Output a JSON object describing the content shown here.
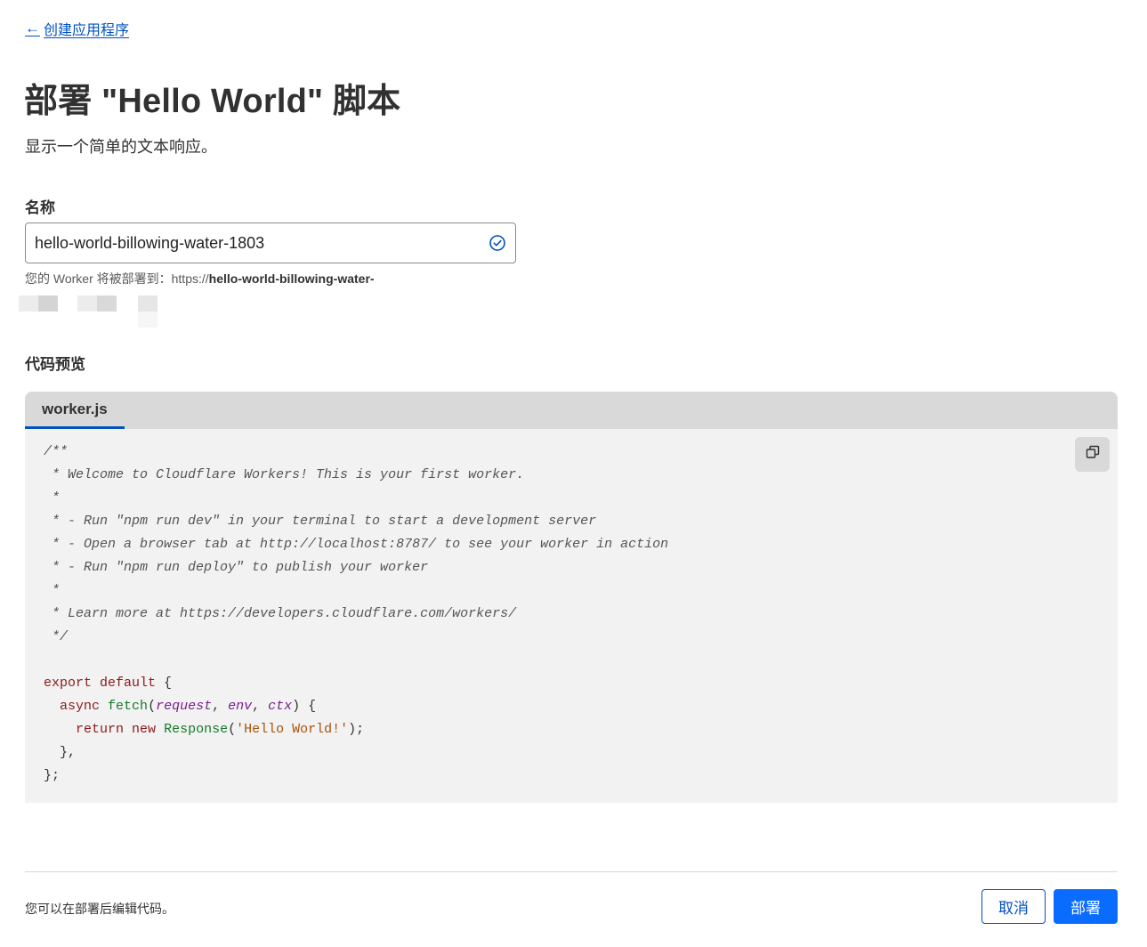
{
  "nav": {
    "back_label": "创建应用程序"
  },
  "header": {
    "title": "部署 \"Hello World\" 脚本",
    "subtitle": "显示一个简单的文本响应。"
  },
  "form": {
    "name_label": "名称",
    "name_value": "hello-world-billowing-water-1803",
    "url_hint_prefix": "您的 Worker 将被部署到：https://",
    "url_hint_host": "hello-world-billowing-water-"
  },
  "preview": {
    "label": "代码预览",
    "tab_label": "worker.js",
    "code_lines": [
      "/**",
      " * Welcome to Cloudflare Workers! This is your first worker.",
      " *",
      " * - Run \"npm run dev\" in your terminal to start a development server",
      " * - Open a browser tab at http://localhost:8787/ to see your worker in action",
      " * - Run \"npm run deploy\" to publish your worker",
      " *",
      " * Learn more at https://developers.cloudflare.com/workers/",
      " */",
      "",
      "export default {",
      "  async fetch(request, env, ctx) {",
      "    return new Response('Hello World!');",
      "  },",
      "};"
    ]
  },
  "footer": {
    "note": "您可以在部署后编辑代码。",
    "cancel_label": "取消",
    "deploy_label": "部署"
  },
  "colors": {
    "link": "#0051c3",
    "primary_button": "#0a6cff",
    "code_background": "#f2f2f2",
    "tab_bar": "#d9d9d9"
  },
  "icons": {
    "back": "arrow-left-icon",
    "valid": "check-circle-icon",
    "copy": "copy-icon"
  }
}
